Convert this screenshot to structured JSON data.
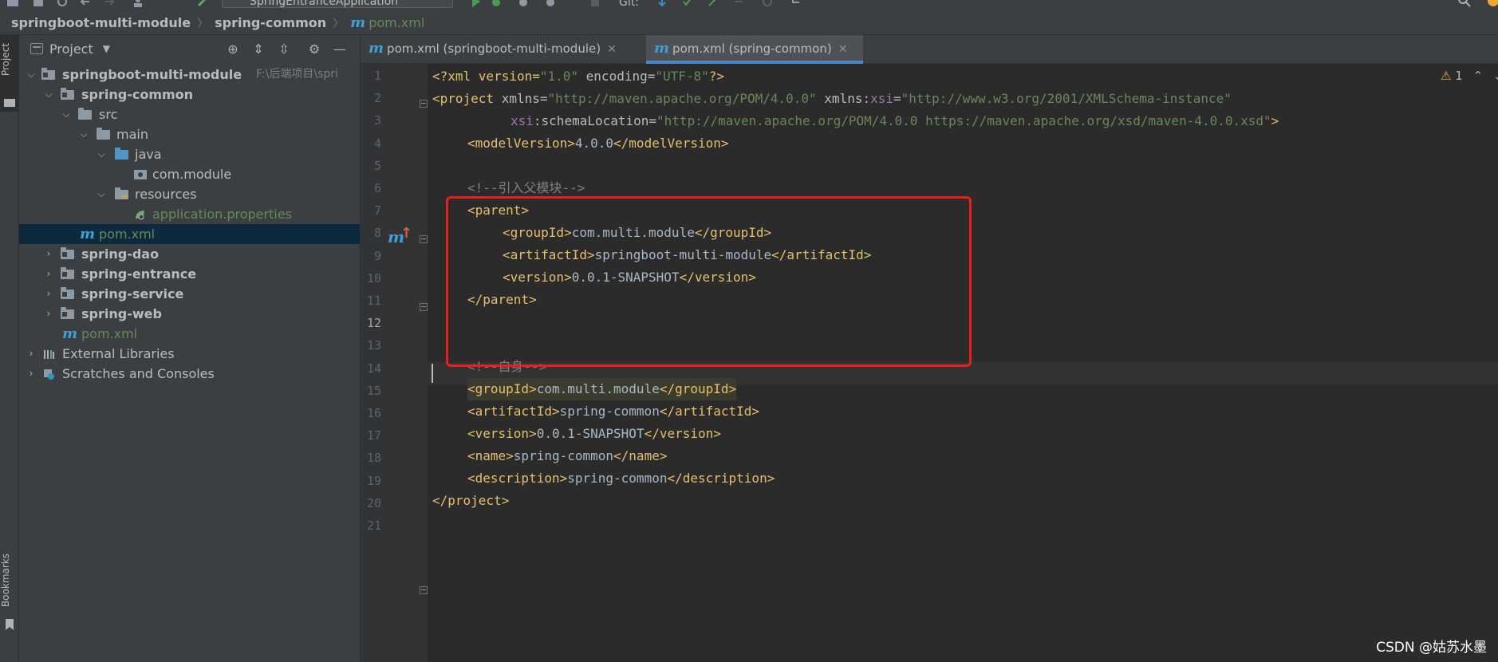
{
  "toolbar": {
    "run_config": "SpringEntranceApplication",
    "git_label": "Git:"
  },
  "breadcrumb": {
    "items": [
      "springboot-multi-module",
      "spring-common"
    ],
    "file": "pom.xml"
  },
  "left_stripe": {
    "project_tab": "Project",
    "bookmarks_tab": "Bookmarks"
  },
  "project_panel": {
    "title": "Project",
    "tree": [
      {
        "label": "springboot-multi-module",
        "hint": "F:\\后端项目\\spri"
      },
      {
        "label": "spring-common"
      },
      {
        "label": "src"
      },
      {
        "label": "main"
      },
      {
        "label": "java"
      },
      {
        "label": "com.module"
      },
      {
        "label": "resources"
      },
      {
        "label": "application.properties"
      },
      {
        "label": "pom.xml"
      },
      {
        "label": "spring-dao"
      },
      {
        "label": "spring-entrance"
      },
      {
        "label": "spring-service"
      },
      {
        "label": "spring-web"
      },
      {
        "label": "pom.xml"
      },
      {
        "label": "External Libraries"
      },
      {
        "label": "Scratches and Consoles"
      }
    ]
  },
  "tabs": [
    {
      "label": "pom.xml (springboot-multi-module)"
    },
    {
      "label": "pom.xml (spring-common)"
    }
  ],
  "editor": {
    "inspection_count": "1",
    "line_numbers": [
      "1",
      "2",
      "3",
      "4",
      "5",
      "6",
      "7",
      "8",
      "9",
      "10",
      "11",
      "12",
      "13",
      "14",
      "15",
      "16",
      "17",
      "18",
      "19",
      "20",
      "21"
    ],
    "lines": {
      "l1": {
        "decl": "<?xml version=",
        "v1": "\"1.0\"",
        "mid": " encoding=",
        "v2": "\"UTF-8\"",
        "end": "?>"
      },
      "l2": {
        "open": "<project",
        "a1": " xmlns=",
        "v1": "\"http://maven.apache.org/POM/4.0.0\"",
        "a2": " xmlns:",
        "ns": "xsi",
        "eq": "=",
        "v2": "\"http://www.w3.org/2001/XMLSchema-instance\""
      },
      "l3": {
        "ns": "xsi",
        "a": ":schemaLocation=",
        "v": "\"http://maven.apache.org/POM/4.0.0 https://maven.apache.org/xsd/maven-4.0.0.xsd\"",
        "end": ">"
      },
      "l4": {
        "open": "<modelVersion>",
        "text": "4.0.0",
        "close": "</modelVersion>"
      },
      "l6": "<!--引入父模块-->",
      "l7": "<parent>",
      "l8": {
        "open": "<groupId>",
        "text": "com.multi.module",
        "close": "</groupId>"
      },
      "l9": {
        "open": "<artifactId>",
        "text": "springboot-multi-module",
        "close": "</artifactId>"
      },
      "l10": {
        "open": "<version>",
        "text": "0.0.1-SNAPSHOT",
        "close": "</version>"
      },
      "l11": "</parent>",
      "l14": "<!--自身-->",
      "l15": {
        "open": "<groupId>",
        "text": "com.multi.module",
        "close": "</groupId>"
      },
      "l16": {
        "open": "<artifactId>",
        "text": "spring-common",
        "close": "</artifactId>"
      },
      "l17": {
        "open": "<version>",
        "text": "0.0.1-SNAPSHOT",
        "close": "</version>"
      },
      "l18": {
        "open": "<name>",
        "text": "spring-common",
        "close": "</name>"
      },
      "l19": {
        "open": "<description>",
        "text": "spring-common",
        "close": "</description>"
      },
      "l20": "</project>"
    }
  },
  "watermark": "CSDN @姑苏水墨",
  "colors": {
    "highlight_box": "#e8201a",
    "maven_icon": "#3ea0d4",
    "tab_underline": "#4a88c7"
  }
}
